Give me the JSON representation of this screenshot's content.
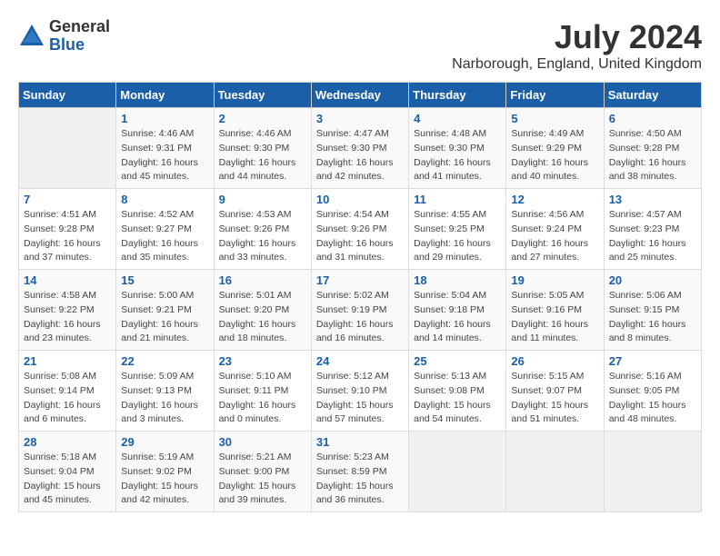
{
  "header": {
    "logo_line1": "General",
    "logo_line2": "Blue",
    "title": "July 2024",
    "subtitle": "Narborough, England, United Kingdom"
  },
  "calendar": {
    "days_of_week": [
      "Sunday",
      "Monday",
      "Tuesday",
      "Wednesday",
      "Thursday",
      "Friday",
      "Saturday"
    ],
    "weeks": [
      [
        {
          "day": "",
          "info": ""
        },
        {
          "day": "1",
          "info": "Sunrise: 4:46 AM\nSunset: 9:31 PM\nDaylight: 16 hours\nand 45 minutes."
        },
        {
          "day": "2",
          "info": "Sunrise: 4:46 AM\nSunset: 9:30 PM\nDaylight: 16 hours\nand 44 minutes."
        },
        {
          "day": "3",
          "info": "Sunrise: 4:47 AM\nSunset: 9:30 PM\nDaylight: 16 hours\nand 42 minutes."
        },
        {
          "day": "4",
          "info": "Sunrise: 4:48 AM\nSunset: 9:30 PM\nDaylight: 16 hours\nand 41 minutes."
        },
        {
          "day": "5",
          "info": "Sunrise: 4:49 AM\nSunset: 9:29 PM\nDaylight: 16 hours\nand 40 minutes."
        },
        {
          "day": "6",
          "info": "Sunrise: 4:50 AM\nSunset: 9:28 PM\nDaylight: 16 hours\nand 38 minutes."
        }
      ],
      [
        {
          "day": "7",
          "info": "Sunrise: 4:51 AM\nSunset: 9:28 PM\nDaylight: 16 hours\nand 37 minutes."
        },
        {
          "day": "8",
          "info": "Sunrise: 4:52 AM\nSunset: 9:27 PM\nDaylight: 16 hours\nand 35 minutes."
        },
        {
          "day": "9",
          "info": "Sunrise: 4:53 AM\nSunset: 9:26 PM\nDaylight: 16 hours\nand 33 minutes."
        },
        {
          "day": "10",
          "info": "Sunrise: 4:54 AM\nSunset: 9:26 PM\nDaylight: 16 hours\nand 31 minutes."
        },
        {
          "day": "11",
          "info": "Sunrise: 4:55 AM\nSunset: 9:25 PM\nDaylight: 16 hours\nand 29 minutes."
        },
        {
          "day": "12",
          "info": "Sunrise: 4:56 AM\nSunset: 9:24 PM\nDaylight: 16 hours\nand 27 minutes."
        },
        {
          "day": "13",
          "info": "Sunrise: 4:57 AM\nSunset: 9:23 PM\nDaylight: 16 hours\nand 25 minutes."
        }
      ],
      [
        {
          "day": "14",
          "info": "Sunrise: 4:58 AM\nSunset: 9:22 PM\nDaylight: 16 hours\nand 23 minutes."
        },
        {
          "day": "15",
          "info": "Sunrise: 5:00 AM\nSunset: 9:21 PM\nDaylight: 16 hours\nand 21 minutes."
        },
        {
          "day": "16",
          "info": "Sunrise: 5:01 AM\nSunset: 9:20 PM\nDaylight: 16 hours\nand 18 minutes."
        },
        {
          "day": "17",
          "info": "Sunrise: 5:02 AM\nSunset: 9:19 PM\nDaylight: 16 hours\nand 16 minutes."
        },
        {
          "day": "18",
          "info": "Sunrise: 5:04 AM\nSunset: 9:18 PM\nDaylight: 16 hours\nand 14 minutes."
        },
        {
          "day": "19",
          "info": "Sunrise: 5:05 AM\nSunset: 9:16 PM\nDaylight: 16 hours\nand 11 minutes."
        },
        {
          "day": "20",
          "info": "Sunrise: 5:06 AM\nSunset: 9:15 PM\nDaylight: 16 hours\nand 8 minutes."
        }
      ],
      [
        {
          "day": "21",
          "info": "Sunrise: 5:08 AM\nSunset: 9:14 PM\nDaylight: 16 hours\nand 6 minutes."
        },
        {
          "day": "22",
          "info": "Sunrise: 5:09 AM\nSunset: 9:13 PM\nDaylight: 16 hours\nand 3 minutes."
        },
        {
          "day": "23",
          "info": "Sunrise: 5:10 AM\nSunset: 9:11 PM\nDaylight: 16 hours\nand 0 minutes."
        },
        {
          "day": "24",
          "info": "Sunrise: 5:12 AM\nSunset: 9:10 PM\nDaylight: 15 hours\nand 57 minutes."
        },
        {
          "day": "25",
          "info": "Sunrise: 5:13 AM\nSunset: 9:08 PM\nDaylight: 15 hours\nand 54 minutes."
        },
        {
          "day": "26",
          "info": "Sunrise: 5:15 AM\nSunset: 9:07 PM\nDaylight: 15 hours\nand 51 minutes."
        },
        {
          "day": "27",
          "info": "Sunrise: 5:16 AM\nSunset: 9:05 PM\nDaylight: 15 hours\nand 48 minutes."
        }
      ],
      [
        {
          "day": "28",
          "info": "Sunrise: 5:18 AM\nSunset: 9:04 PM\nDaylight: 15 hours\nand 45 minutes."
        },
        {
          "day": "29",
          "info": "Sunrise: 5:19 AM\nSunset: 9:02 PM\nDaylight: 15 hours\nand 42 minutes."
        },
        {
          "day": "30",
          "info": "Sunrise: 5:21 AM\nSunset: 9:00 PM\nDaylight: 15 hours\nand 39 minutes."
        },
        {
          "day": "31",
          "info": "Sunrise: 5:23 AM\nSunset: 8:59 PM\nDaylight: 15 hours\nand 36 minutes."
        },
        {
          "day": "",
          "info": ""
        },
        {
          "day": "",
          "info": ""
        },
        {
          "day": "",
          "info": ""
        }
      ]
    ]
  }
}
